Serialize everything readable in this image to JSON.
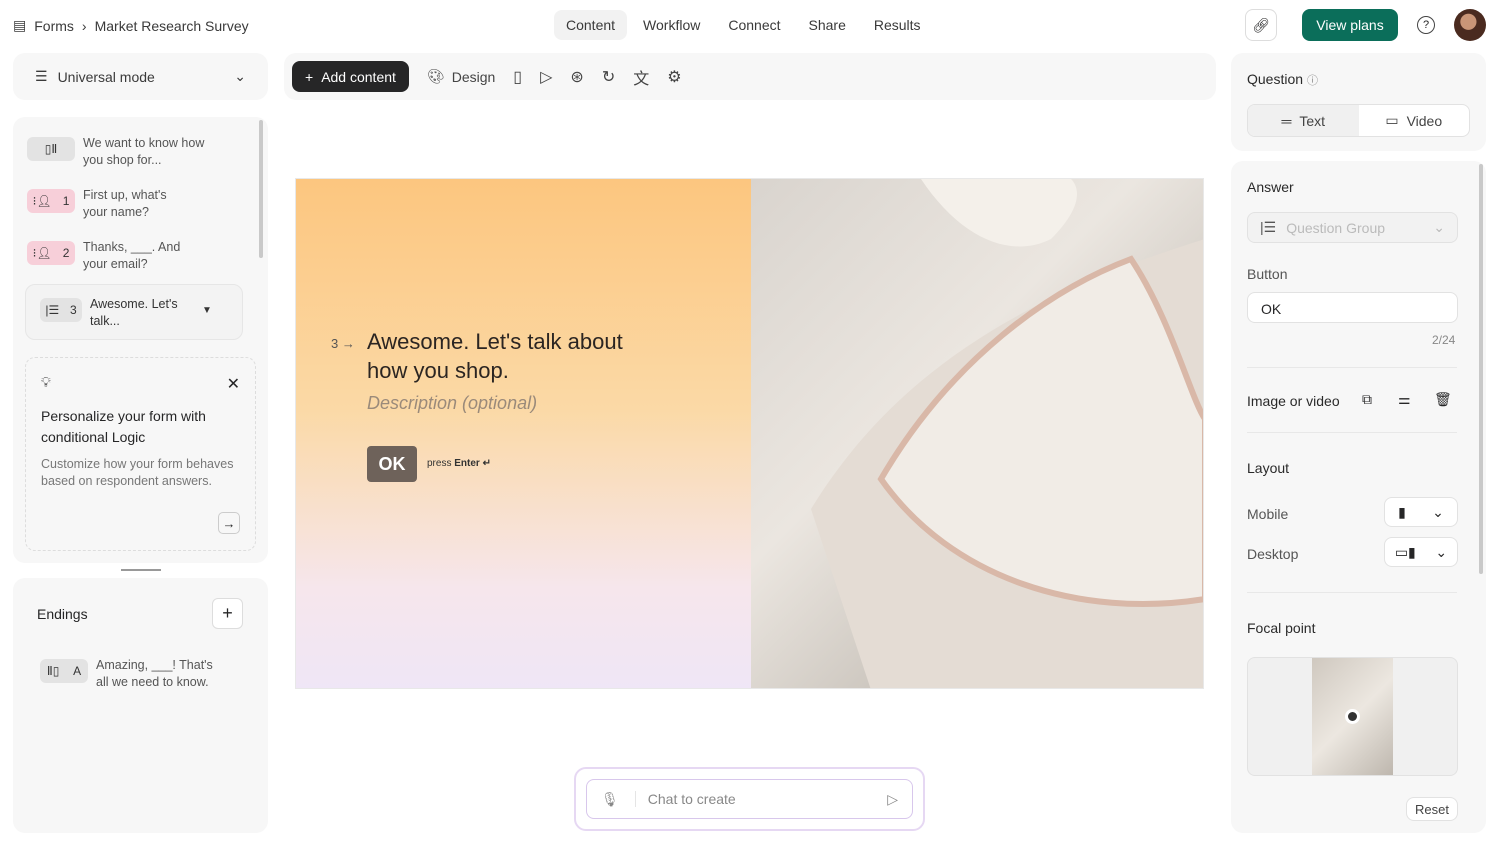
{
  "header": {
    "breadcrumb": [
      "Forms",
      "Market Research Survey"
    ],
    "tabs": [
      "Content",
      "Workflow",
      "Connect",
      "Share",
      "Results"
    ],
    "active_tab": "Content",
    "view_plans": "View plans",
    "help": "?"
  },
  "mode": {
    "label": "Universal mode"
  },
  "toolbar": {
    "add_content": "Add content",
    "design": "Design"
  },
  "questions": [
    {
      "badge": "",
      "text": "We want to know how you shop for..."
    },
    {
      "badge": "1",
      "text": "First up, what's your name?"
    },
    {
      "badge": "2",
      "text": "Thanks, ___. And your email?"
    },
    {
      "badge": "3",
      "text": "Awesome. Let's talk..."
    }
  ],
  "tip": {
    "title": "Personalize your form with conditional Logic",
    "body": "Customize how your form behaves based on respondent answers."
  },
  "endings": {
    "title": "Endings",
    "items": [
      {
        "badge": "A",
        "text": "Amazing, ___! That's all we need to know."
      }
    ]
  },
  "preview": {
    "number": "3",
    "title": "Awesome. Let's talk about how you shop.",
    "description": "Description (optional)",
    "button": "OK",
    "hint_press": "press",
    "hint_key": "Enter ↵"
  },
  "chat": {
    "placeholder": "Chat to create"
  },
  "settings": {
    "question_label": "Question",
    "type_options": [
      "Text",
      "Video"
    ],
    "selected_type": "Text",
    "answer_label": "Answer",
    "answer_type": "Question Group",
    "button_label": "Button",
    "button_value": "OK",
    "char_count": "2/24",
    "image_label": "Image or video",
    "layout_label": "Layout",
    "mobile_label": "Mobile",
    "desktop_label": "Desktop",
    "focal_label": "Focal point",
    "reset": "Reset"
  },
  "colors": {
    "accent": "#0b6e5a",
    "badge_pink": "#f7cfd9",
    "dark": "#262627"
  }
}
